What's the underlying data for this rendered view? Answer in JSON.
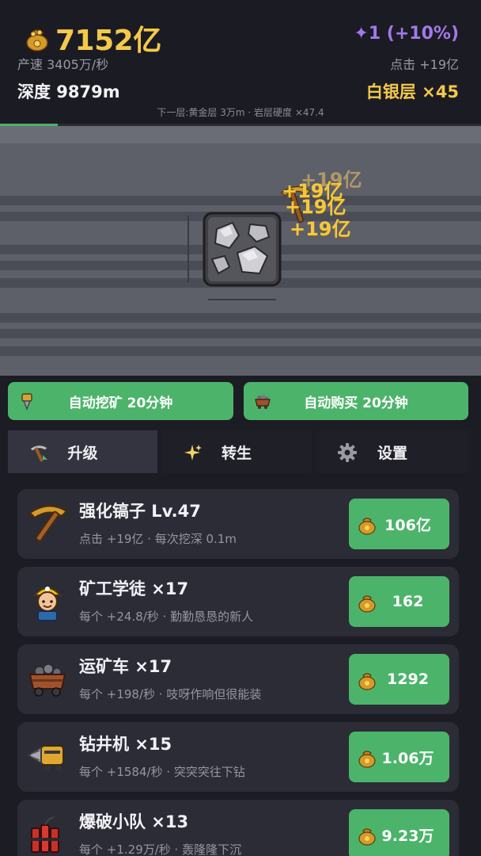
{
  "header": {
    "gold": "7152亿",
    "gem": "✦1 (+10%)",
    "rate": "产速 3405万/秒",
    "click": "点击 +19亿",
    "depth": "深度 9879m",
    "layer": "白银层 ×45",
    "next": "下一层:黄金层 3万m · 岩层硬度 ×47.4",
    "progress": 0.12
  },
  "mine": {
    "floats": [
      "+19亿",
      "+19亿",
      "+19亿",
      "+19亿"
    ]
  },
  "auto": {
    "mine_label": "自动挖矿 20分钟",
    "buy_label": "自动购买 20分钟"
  },
  "tabs": [
    {
      "label": "升级",
      "icon": "pickaxe-icon"
    },
    {
      "label": "转生",
      "icon": "sparkle-icon"
    },
    {
      "label": "设置",
      "icon": "gear-icon"
    }
  ],
  "upgrades": [
    {
      "name": "强化镐子 Lv.47",
      "desc": "点击 +19亿 · 每次挖深 0.1m",
      "price": "106亿",
      "icon": "pickaxe-icon"
    },
    {
      "name": "矿工学徒 ×17",
      "desc": "每个 +24.8/秒 · 勤勤恳恳的新人",
      "price": "162",
      "icon": "miner-icon"
    },
    {
      "name": "运矿车 ×17",
      "desc": "每个 +198/秒 · 吱呀作响但很能装",
      "price": "1292",
      "icon": "minecart-icon"
    },
    {
      "name": "钻井机 ×15",
      "desc": "每个 +1584/秒 · 突突突往下钻",
      "price": "1.06万",
      "icon": "drill-icon"
    },
    {
      "name": "爆破小队 ×13",
      "desc": "每个 +1.29万/秒 · 轰隆隆下沉",
      "price": "9.23万",
      "icon": "dynamite-icon"
    }
  ],
  "colors": {
    "accent_green": "#4cb46a",
    "gold": "#f4c94a",
    "gem": "#a279e8"
  }
}
